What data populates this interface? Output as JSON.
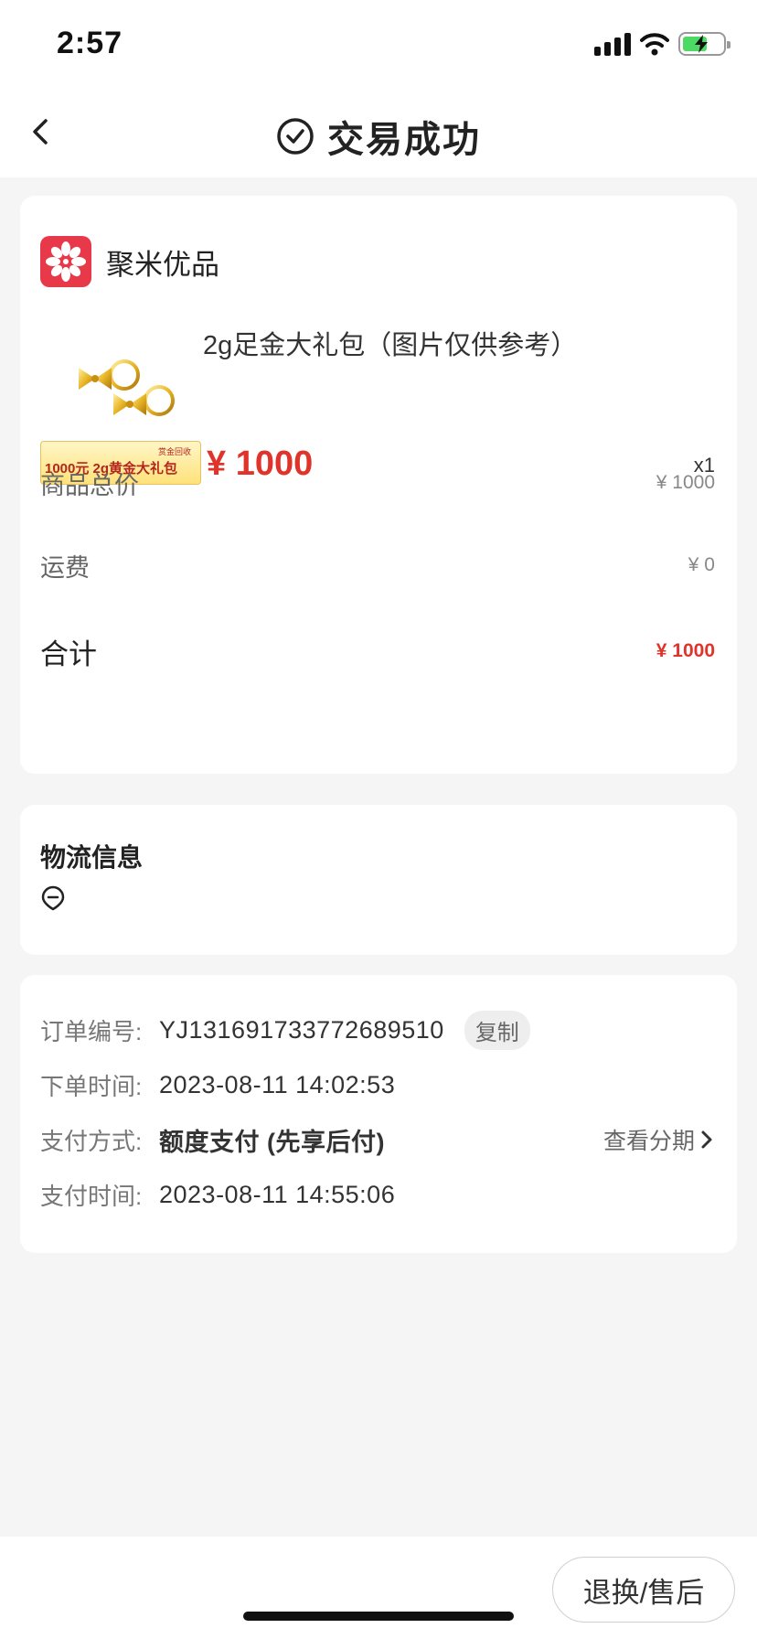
{
  "status_bar": {
    "time": "2:57"
  },
  "nav": {
    "title": "交易成功"
  },
  "shop": {
    "name": "聚米优品"
  },
  "product": {
    "title": "2g足金大礼包（图片仅供参考）",
    "price": "¥ 1000",
    "quantity": "x1",
    "banner_text": "1000元  2g黄金大礼包",
    "banner_tag": "赏金回收"
  },
  "summary": {
    "subtotal_label": "商品总价",
    "subtotal_value": "¥ 1000",
    "shipping_label": "运费",
    "shipping_value": "¥ 0",
    "total_label": "合计",
    "total_value": "¥ 1000"
  },
  "logistics": {
    "title": "物流信息"
  },
  "order": {
    "number_label": "订单编号:",
    "number_value": "YJ131691733772689510",
    "copy_label": "复制",
    "created_label": "下单时间:",
    "created_value": "2023-08-11 14:02:53",
    "pay_method_label": "支付方式:",
    "pay_method_value": "额度支付 (先享后付)",
    "installment_link": "查看分期",
    "paid_label": "支付时间:",
    "paid_value": "2023-08-11 14:55:06"
  },
  "footer": {
    "after_sale_label": "退换/售后"
  },
  "colors": {
    "accent_red": "#e0342b",
    "brand_red": "#e8394a",
    "background": "#f5f5f5"
  }
}
